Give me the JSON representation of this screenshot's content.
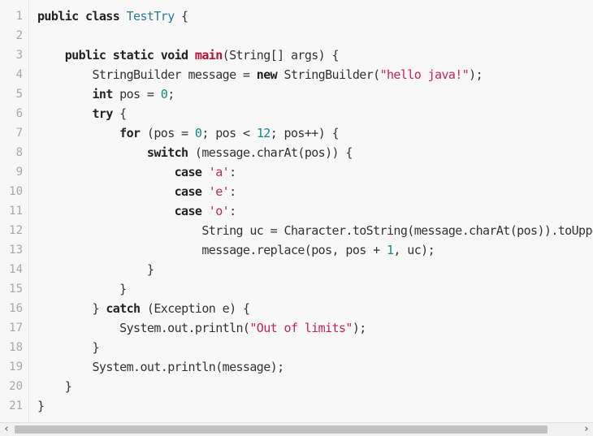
{
  "editor": {
    "language": "java",
    "line_numbers": [
      "1",
      "2",
      "3",
      "4",
      "5",
      "6",
      "7",
      "8",
      "9",
      "10",
      "11",
      "12",
      "13",
      "14",
      "15",
      "16",
      "17",
      "18",
      "19",
      "20",
      "21"
    ],
    "lines": [
      {
        "indent": "",
        "tokens": [
          {
            "t": "public class ",
            "c": "kw"
          },
          {
            "t": "TestTry",
            "c": "ty"
          },
          {
            "t": " {",
            "c": ""
          }
        ]
      },
      {
        "indent": "",
        "tokens": []
      },
      {
        "indent": "    ",
        "tokens": [
          {
            "t": "public static void ",
            "c": "kw"
          },
          {
            "t": "main",
            "c": "fn"
          },
          {
            "t": "(String[] args) {",
            "c": ""
          }
        ]
      },
      {
        "indent": "        ",
        "tokens": [
          {
            "t": "StringBuilder message = ",
            "c": ""
          },
          {
            "t": "new",
            "c": "kw"
          },
          {
            "t": " StringBuilder(",
            "c": ""
          },
          {
            "t": "\"hello java!\"",
            "c": "st"
          },
          {
            "t": ");",
            "c": ""
          }
        ]
      },
      {
        "indent": "        ",
        "tokens": [
          {
            "t": "int",
            "c": "kw"
          },
          {
            "t": " pos = ",
            "c": ""
          },
          {
            "t": "0",
            "c": "nu"
          },
          {
            "t": ";",
            "c": ""
          }
        ]
      },
      {
        "indent": "        ",
        "tokens": [
          {
            "t": "try",
            "c": "kw"
          },
          {
            "t": " {",
            "c": ""
          }
        ]
      },
      {
        "indent": "            ",
        "tokens": [
          {
            "t": "for",
            "c": "kw"
          },
          {
            "t": " (pos = ",
            "c": ""
          },
          {
            "t": "0",
            "c": "nu"
          },
          {
            "t": "; pos < ",
            "c": ""
          },
          {
            "t": "12",
            "c": "nu"
          },
          {
            "t": "; pos++) {",
            "c": ""
          }
        ]
      },
      {
        "indent": "                ",
        "tokens": [
          {
            "t": "switch",
            "c": "kw"
          },
          {
            "t": " (message.charAt(pos)) {",
            "c": ""
          }
        ]
      },
      {
        "indent": "                    ",
        "tokens": [
          {
            "t": "case",
            "c": "kw"
          },
          {
            "t": " ",
            "c": ""
          },
          {
            "t": "'a'",
            "c": "st"
          },
          {
            "t": ":",
            "c": ""
          }
        ]
      },
      {
        "indent": "                    ",
        "tokens": [
          {
            "t": "case",
            "c": "kw"
          },
          {
            "t": " ",
            "c": ""
          },
          {
            "t": "'e'",
            "c": "st"
          },
          {
            "t": ":",
            "c": ""
          }
        ]
      },
      {
        "indent": "                    ",
        "tokens": [
          {
            "t": "case",
            "c": "kw"
          },
          {
            "t": " ",
            "c": ""
          },
          {
            "t": "'o'",
            "c": "st"
          },
          {
            "t": ":",
            "c": ""
          }
        ]
      },
      {
        "indent": "                        ",
        "tokens": [
          {
            "t": "String uc = Character.toString(message.charAt(pos)).toUpperCase();",
            "c": ""
          }
        ]
      },
      {
        "indent": "                        ",
        "tokens": [
          {
            "t": "message.replace(pos, pos + ",
            "c": ""
          },
          {
            "t": "1",
            "c": "nu"
          },
          {
            "t": ", uc);",
            "c": ""
          }
        ]
      },
      {
        "indent": "                ",
        "tokens": [
          {
            "t": "}",
            "c": ""
          }
        ]
      },
      {
        "indent": "            ",
        "tokens": [
          {
            "t": "}",
            "c": ""
          }
        ]
      },
      {
        "indent": "        ",
        "tokens": [
          {
            "t": "} ",
            "c": ""
          },
          {
            "t": "catch",
            "c": "kw"
          },
          {
            "t": " (Exception e) {",
            "c": ""
          }
        ]
      },
      {
        "indent": "            ",
        "tokens": [
          {
            "t": "System.out.println(",
            "c": ""
          },
          {
            "t": "\"Out of limits\"",
            "c": "st"
          },
          {
            "t": ");",
            "c": ""
          }
        ]
      },
      {
        "indent": "        ",
        "tokens": [
          {
            "t": "}",
            "c": ""
          }
        ]
      },
      {
        "indent": "        ",
        "tokens": [
          {
            "t": "System.out.println(message);",
            "c": ""
          }
        ]
      },
      {
        "indent": "    ",
        "tokens": [
          {
            "t": "}",
            "c": ""
          }
        ]
      },
      {
        "indent": "",
        "tokens": [
          {
            "t": "}",
            "c": ""
          }
        ]
      }
    ]
  },
  "scrollbar": {
    "left_arrow": "‹",
    "right_arrow": "›",
    "thumb_fraction": 0.9
  },
  "colors": {
    "keyword": "#222222",
    "type": "#2b7a9c",
    "method_name": "#b71234",
    "string": "#c7254e",
    "number": "#12878b",
    "gutter_text": "#a8a8a8"
  }
}
